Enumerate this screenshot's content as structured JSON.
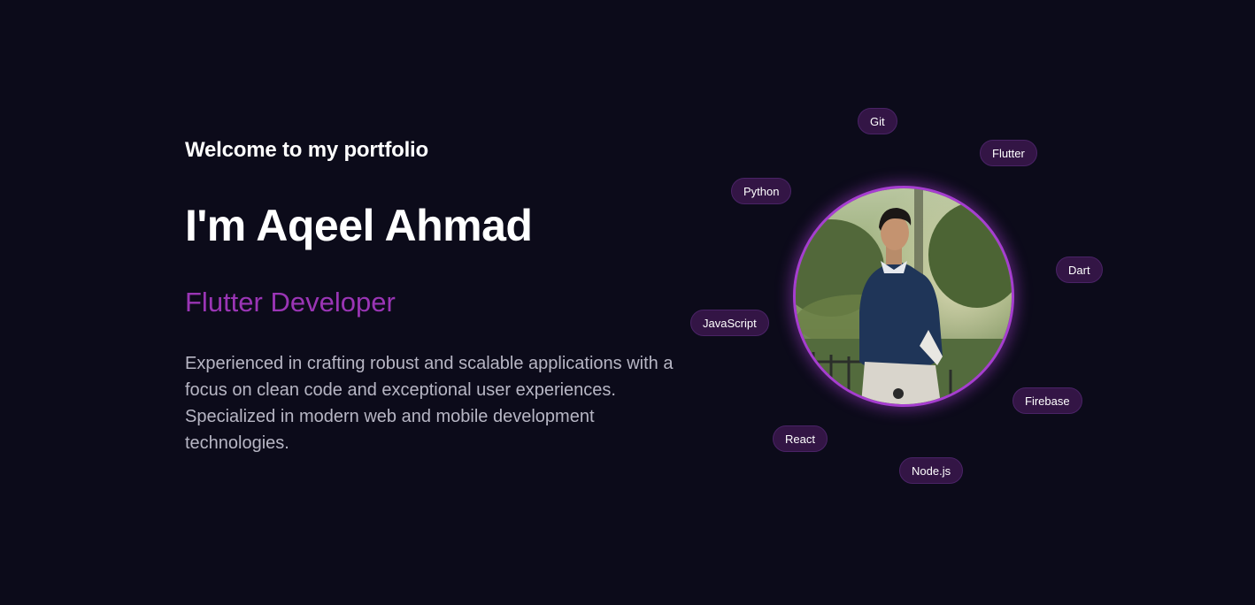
{
  "hero": {
    "welcome": "Welcome to my portfolio",
    "name": "I'm Aqeel Ahmad",
    "role": "Flutter Developer",
    "bio": "Experienced in crafting robust and scalable applications with a focus on clean code and exceptional user experiences. Specialized in modern web and mobile development technologies."
  },
  "skills": [
    "Git",
    "Flutter",
    "Python",
    "Dart",
    "JavaScript",
    "Firebase",
    "React",
    "Node.js"
  ],
  "colors": {
    "background": "#0c0b1a",
    "accent": "#9a35b5",
    "ring": "#a63ed0",
    "chip_bg": "#331545",
    "text_muted": "#b7b6c4"
  }
}
